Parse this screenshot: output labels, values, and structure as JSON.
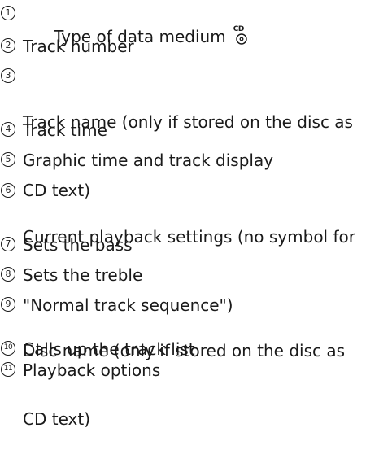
{
  "items": [
    {
      "number": "1",
      "lines": [
        "Type of data medium"
      ],
      "icon": "cd-disc-icon",
      "icon_label": "CD"
    },
    {
      "number": "2",
      "lines": [
        "Track number"
      ]
    },
    {
      "number": "3",
      "lines": [
        "Track name (only if stored on the disc as",
        "CD text)"
      ]
    },
    {
      "number": "4",
      "lines": [
        "Track time"
      ]
    },
    {
      "number": "5",
      "lines": [
        "Graphic time and track display"
      ]
    },
    {
      "number": "6",
      "lines": [
        "Current playback settings (no symbol for",
        "\"Normal track sequence\")"
      ]
    },
    {
      "number": "7",
      "lines": [
        "Sets the bass"
      ]
    },
    {
      "number": "8",
      "lines": [
        "Sets the treble"
      ]
    },
    {
      "number": "9",
      "lines": [
        "Disc name (only if stored on the disc as",
        "CD text)"
      ]
    },
    {
      "number": "10",
      "lines": [
        "Calls up the track list"
      ]
    },
    {
      "number": "11",
      "lines": [
        "Playback options"
      ]
    }
  ]
}
